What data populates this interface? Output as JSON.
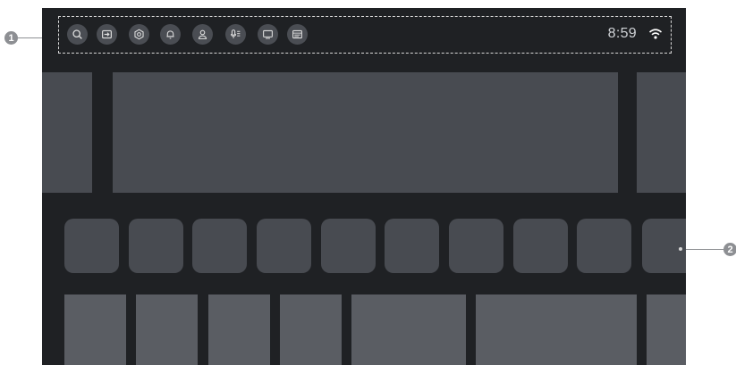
{
  "status_bar": {
    "time": "8:59",
    "icons": [
      "search-icon",
      "input-source-icon",
      "settings-icon",
      "notification-icon",
      "profile-icon",
      "voice-assistant-icon",
      "screen-icon",
      "guide-icon"
    ]
  },
  "callouts": {
    "one": "1",
    "two": "2"
  }
}
